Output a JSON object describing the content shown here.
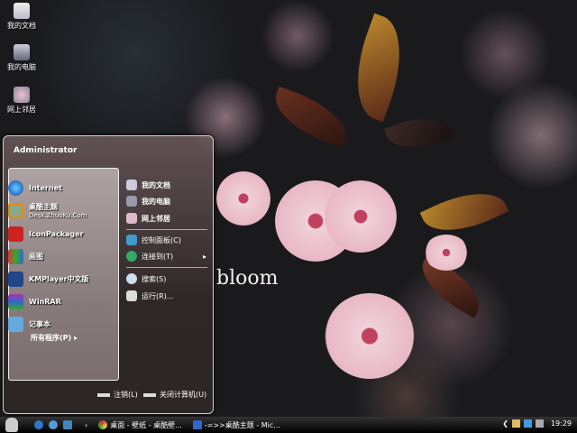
{
  "desktop": {
    "icons": [
      {
        "label": "我的文档"
      },
      {
        "label": "我的电脑"
      },
      {
        "label": "网上邻居"
      }
    ],
    "wallpaper_text": "bloom"
  },
  "start_menu": {
    "user": "Administrator",
    "pinned": [
      {
        "label": "Internet",
        "icon": "ie-icon"
      },
      {
        "label": "桌酷主题",
        "sub": "Desk.ZhuoKu.Com",
        "icon": "theme-icon"
      },
      {
        "label": "IconPackager",
        "icon": "iconpackager-icon"
      },
      {
        "label": "画图",
        "icon": "paint-icon"
      },
      {
        "label": "KMPlayer中文版",
        "icon": "kmplayer-icon"
      },
      {
        "label": "WinRAR",
        "icon": "winrar-icon"
      },
      {
        "label": "记事本",
        "icon": "notepad-icon"
      }
    ],
    "all_programs": "所有程序(P)",
    "right": [
      {
        "label": "我的文档"
      },
      {
        "label": "我的电脑"
      },
      {
        "label": "网上邻居"
      },
      {
        "label": "控制面板(C)"
      },
      {
        "label": "连接到(T)"
      },
      {
        "label": "搜索(S)"
      },
      {
        "label": "运行(R)..."
      }
    ],
    "logoff": "注销(L)",
    "shutdown": "关闭计算机(U)"
  },
  "taskbar": {
    "tasks": [
      {
        "label": "桌面 - 壁纸 - 桌酷壁..."
      },
      {
        "label": "-=>>桌酷主题 - Mic..."
      }
    ],
    "clock": "19:29"
  },
  "colors": {
    "taskbar": "#000000",
    "menu": "#3a3030"
  }
}
